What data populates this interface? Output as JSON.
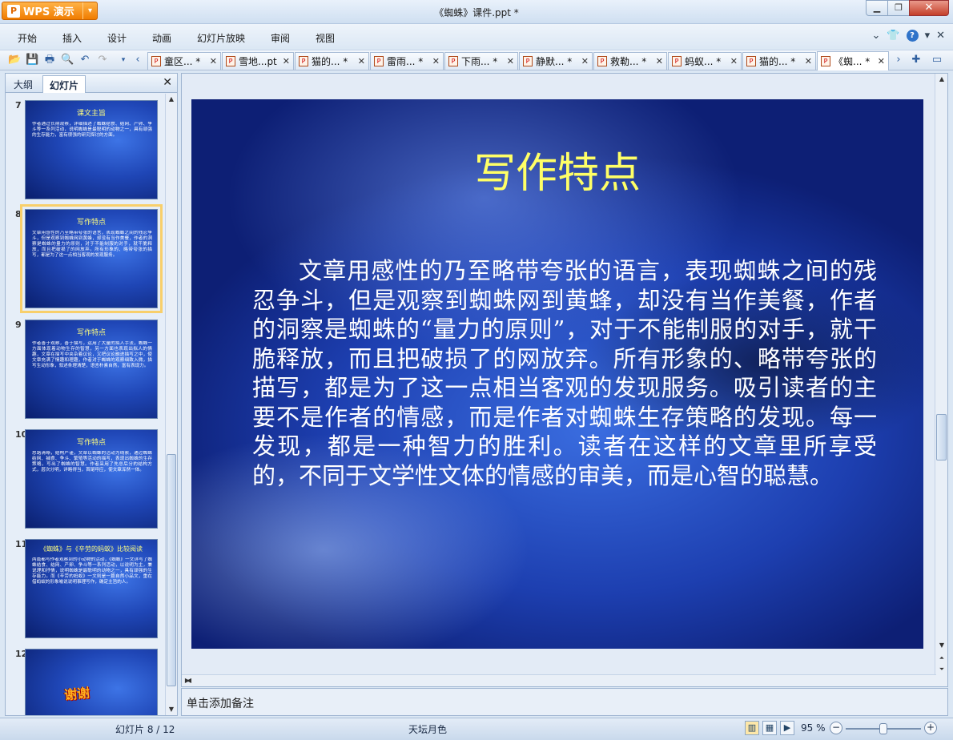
{
  "app": {
    "logo_label": "WPS 演示",
    "title": "《蜘蛛》课件.ppt *"
  },
  "menu": [
    "开始",
    "插入",
    "设计",
    "动画",
    "幻灯片放映",
    "审阅",
    "视图"
  ],
  "tabs": [
    {
      "label": "童区...",
      "mark": "*"
    },
    {
      "label": "雪地...pt",
      "mark": ""
    },
    {
      "label": "猫的...",
      "mark": "*"
    },
    {
      "label": "雷雨...",
      "mark": "*"
    },
    {
      "label": "下雨...",
      "mark": "*"
    },
    {
      "label": "静默...",
      "mark": "*"
    },
    {
      "label": "救勒...",
      "mark": "*"
    },
    {
      "label": "蚂蚁...",
      "mark": "*"
    },
    {
      "label": "猫的...",
      "mark": "*"
    },
    {
      "label": "《蜘...",
      "mark": "*"
    }
  ],
  "panel": {
    "tab_outline": "大纲",
    "tab_slides": "幻灯片"
  },
  "thumbnails": [
    {
      "num": "7",
      "title": "课文主旨",
      "body": "作者通过长期观察，详细描述了蜘蛛结食、结网、产卵、争斗等一系列活动，说明蜘蛛是最聪明的动物之一，具有顽强的生存能力，富有很强的研究探讨的方面。"
    },
    {
      "num": "8",
      "title": "写作特点",
      "body": "文章用感性的乃至略带夸张的语言，表现蜘蛛之间的残忍争斗，但是观察到蜘蛛网到黄蜂，却没有当作美餐，作者的洞察是蜘蛛的量力的原则，对于不能制服的对手，就干脆释放，而且把破损了的网放弃。所有形象的、略带夸张的描写，都是为了这一点相当客观的发现服务。"
    },
    {
      "num": "9",
      "title": "写作特点",
      "body": "作者善于观察，善于描写，运用了大量的拟人手法，蜘蛛一方面体现着动物生存的智慧，另一方面也表现出拟人的情趣，文章在描写中夹杂着议论，又把议论融进描写之中，使文章充满了情趣和理趣，作者对于蜘蛛的观察细致入微，描写生动形象，叙述条理清楚，语言朴素自然，富有表现力。"
    },
    {
      "num": "10",
      "title": "写作特点",
      "body": "思路清晰，结构严谨，文章以蜘蛛的活动为线索，通过蜘蛛结网、捕食、争斗、繁殖等活动的描写，表现出蜘蛛的生存策略，写出了蜘蛛的智慧。作者采用了先总后分的结构方式，层次分明，详略得当，首尾呼应，使文章浑然一体。"
    },
    {
      "num": "11",
      "title": "《蜘蛛》与《辛劳的蚂蚁》比较阅读",
      "body": "两篇都写作者观察到的小动物的活动，《蜘蛛》一文详写了蜘蛛结食、结网、产卵、争斗等一系列活动，以说明为主，兼说理和抒情，说明蜘蛛是最聪明的动物之一，具有顽强的生存能力。而《辛劳的蚂蚁》一文则是一篇自然小品文，重在借蚂蚁的形象喻说说明事理写作，确定主旨的人。"
    },
    {
      "num": "12",
      "title": "谢谢",
      "body": ""
    }
  ],
  "slide": {
    "title": "写作特点",
    "body": "文章用感性的乃至略带夸张的语言，表现蜘蛛之间的残忍争斗，但是观察到蜘蛛网到黄蜂，却没有当作美餐，作者的洞察是蜘蛛的“量力的原则”，对于不能制服的对手，就干脆释放，而且把破损了的网放弃。所有形象的、略带夸张的描写，都是为了这一点相当客观的发现服务。吸引读者的主要不是作者的情感，而是作者对蜘蛛生存策略的发现。每一发现，都是一种智力的胜利。读者在这样的文章里所享受的，不同于文学性文体的情感的审美，而是心智的聪慧。"
  },
  "notes": {
    "placeholder": "单击添加备注"
  },
  "status": {
    "slide_indicator": "幻灯片 8 / 12",
    "theme": "天坛月色",
    "zoom": "95 %",
    "zoom_fraction": 0.5
  },
  "colors": {
    "slide_title": "#ffff66",
    "accent": "#f07c00"
  }
}
